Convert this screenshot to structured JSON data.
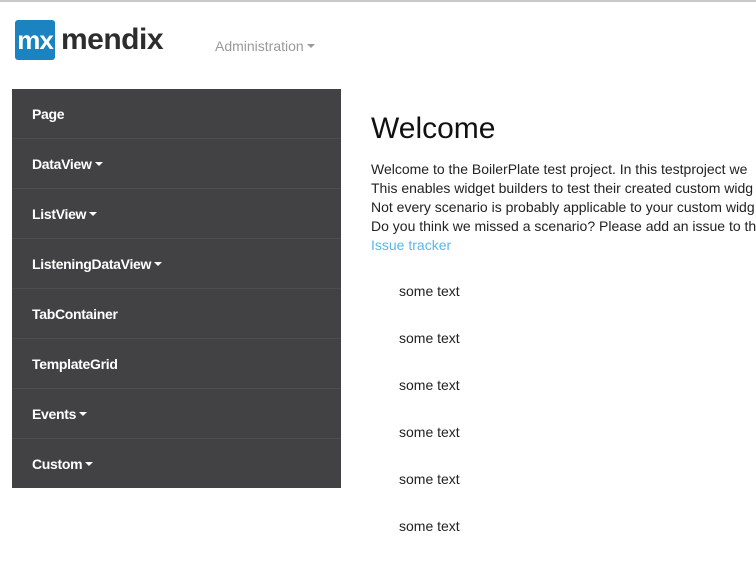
{
  "brand": {
    "badge": "mx",
    "name": "mendix",
    "badge_color": "#1b83c0"
  },
  "header": {
    "admin_menu_label": "Administration"
  },
  "sidebar": {
    "background": "#424244",
    "items": [
      {
        "label": "Page",
        "has_dropdown": false
      },
      {
        "label": "DataView",
        "has_dropdown": true
      },
      {
        "label": "ListView",
        "has_dropdown": true
      },
      {
        "label": "ListeningDataView",
        "has_dropdown": true
      },
      {
        "label": "TabContainer",
        "has_dropdown": false
      },
      {
        "label": "TemplateGrid",
        "has_dropdown": false
      },
      {
        "label": "Events",
        "has_dropdown": true
      },
      {
        "label": "Custom",
        "has_dropdown": true
      }
    ]
  },
  "main": {
    "title": "Welcome",
    "intro_lines": [
      "Welcome to the BoilerPlate test project. In this testproject we",
      "This enables widget builders to test their created custom widg",
      "Not every scenario is probably applicable to your custom widg",
      "Do you think we missed a scenario? Please add an issue to th"
    ],
    "link_label": "Issue tracker",
    "link_color": "#5bb7e6",
    "texts": [
      "some text",
      "some text",
      "some text",
      "some text",
      "some text",
      "some text"
    ]
  }
}
